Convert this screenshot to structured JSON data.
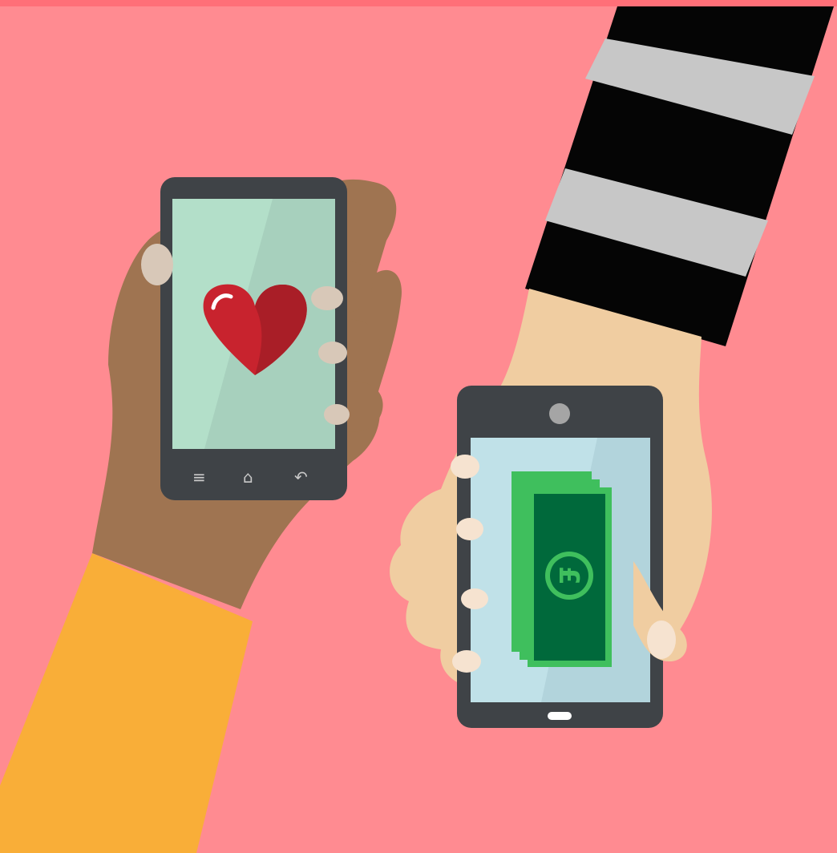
{
  "scene": {
    "description_icons": [
      "heart-icon",
      "cash-icon",
      "menu-icon",
      "home-icon",
      "back-icon"
    ],
    "colors": {
      "background": "#ff8b91",
      "top_stripe": "#ff6f78",
      "phone_body": "#3f4347",
      "left_screen": "#b3dfc9",
      "right_screen": "#c0e1e8",
      "heart_red": "#c8232e",
      "cash_green": "#00693b",
      "cash_light_green": "#3fbf5d",
      "dark_hand": "#9f7451",
      "light_hand": "#f0cda1",
      "sleeve_yellow": "#f9ae38",
      "sleeve_stripe_black": "#050505",
      "sleeve_stripe_gray": "#c7c7c7"
    },
    "nav_buttons": {
      "menu": "≡",
      "home": "⌂",
      "back": "↶"
    }
  }
}
